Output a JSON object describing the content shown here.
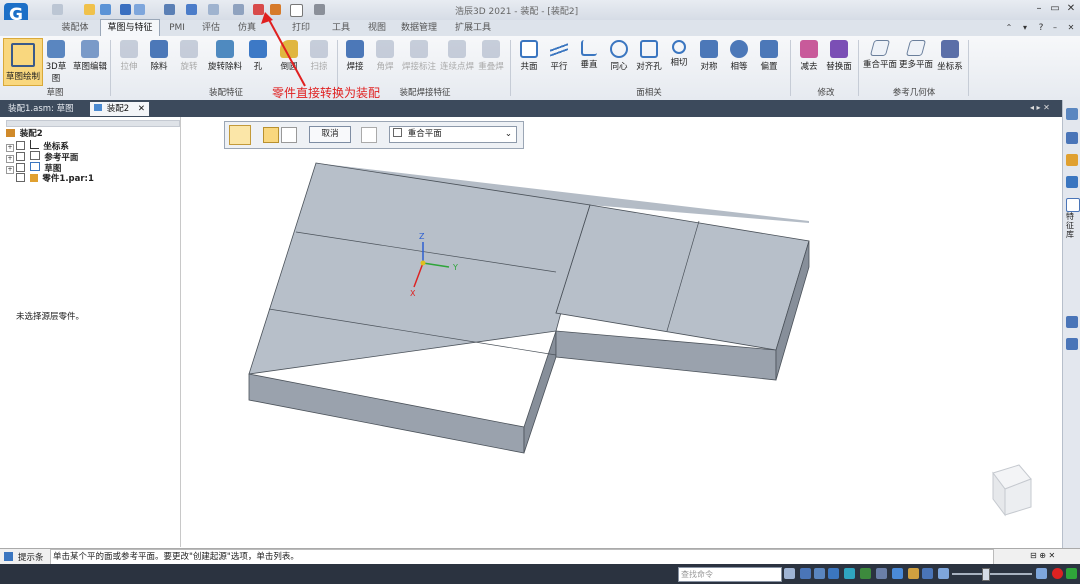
{
  "app": {
    "logo_text": "G",
    "window_title": "浩辰3D 2021 - 装配 - [装配2]"
  },
  "tabs": [
    {
      "label": "装配体",
      "active": false
    },
    {
      "label": "草图与特征",
      "active": true
    },
    {
      "label": "PMI",
      "active": false
    },
    {
      "label": "评估",
      "active": false
    },
    {
      "label": "仿真",
      "active": false
    },
    {
      "label": "视图",
      "active": false
    },
    {
      "label": "打印",
      "active": false
    },
    {
      "label": "工具",
      "active": false
    },
    {
      "label": "视图",
      "active": false
    },
    {
      "label": "数据管理",
      "active": false
    },
    {
      "label": "扩展工具",
      "active": false
    }
  ],
  "ribbon": {
    "sketch_group": {
      "label": "草图",
      "items": [
        "草图绘制",
        "3D草图",
        "草图编辑"
      ]
    },
    "feature_group": {
      "label": "装配特征",
      "items": [
        {
          "label": "拉伸",
          "disabled": true
        },
        {
          "label": "除料",
          "disabled": false
        },
        {
          "label": "旋转",
          "disabled": true
        },
        {
          "label": "旋转除料",
          "disabled": false
        },
        {
          "label": "孔",
          "disabled": false
        },
        {
          "label": "倒圆",
          "disabled": false
        },
        {
          "label": "扫掠",
          "disabled": true
        }
      ]
    },
    "weld_group": {
      "label": "装配焊接特征",
      "items": [
        {
          "label": "焊接",
          "disabled": false
        },
        {
          "label": "角焊",
          "disabled": true
        },
        {
          "label": "焊接标注",
          "disabled": true
        },
        {
          "label": "连续点焊",
          "disabled": true
        },
        {
          "label": "重叠焊",
          "disabled": true
        }
      ]
    },
    "relation_group": {
      "label": "面相关",
      "items": [
        "共面",
        "平行",
        "垂直",
        "同心",
        "对齐孔",
        "相切",
        "对称",
        "相等",
        "偏置"
      ]
    },
    "modify_group": {
      "label": "修改",
      "items": [
        "减去",
        "替换面"
      ]
    },
    "refgeo_group": {
      "label": "参考几何体",
      "items": [
        "重合平面",
        "更多平面",
        "坐标系"
      ]
    }
  },
  "annotation": "零件直接转换为装配",
  "doc_tabs": [
    {
      "label": "装配1.asm: 草图",
      "active": false
    },
    {
      "label": "装配2",
      "active": true
    }
  ],
  "tree": {
    "root": "装配2",
    "items": [
      "坐标系",
      "参考平面",
      "草图",
      "零件1.par:1"
    ]
  },
  "left_panel_message": "未选择源层零件。",
  "command_bar": {
    "cancel_label": "取消",
    "plane_option": "重合平面"
  },
  "axes": {
    "x": "X",
    "y": "Y",
    "z": "Z"
  },
  "status": {
    "prompt_label": "提示条",
    "prompt_text": "单击某个平的面或参考平面。要更改\"创建起源\"选项，单击列表。"
  },
  "bottom": {
    "search_placeholder": "查找命令"
  },
  "right_panel_label": "特征库"
}
